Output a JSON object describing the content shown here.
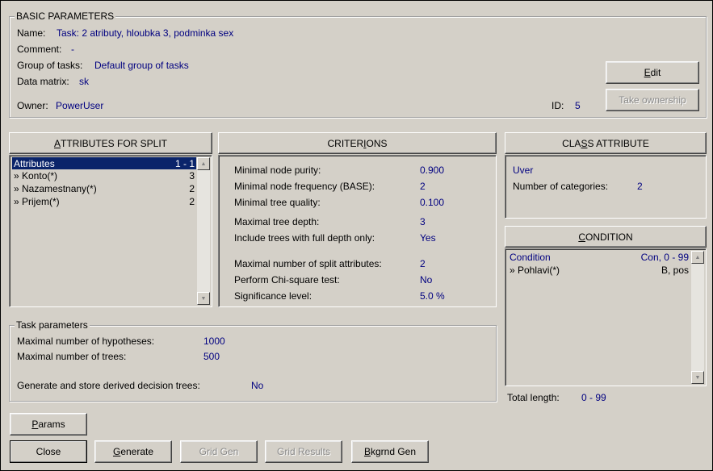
{
  "basic": {
    "title": "BASIC PARAMETERS",
    "name_label": "Name:",
    "name_value": "Task:  2 atributy, hloubka 3, podminka sex",
    "comment_label": "Comment:",
    "comment_value": "-",
    "group_label": "Group of tasks:",
    "group_value": "Default group of tasks",
    "matrix_label": "Data matrix:",
    "matrix_value": "sk",
    "owner_label": "Owner:",
    "owner_value": "PowerUser",
    "id_label": "ID:",
    "id_value": "5",
    "edit_pre": "",
    "edit_ul": "E",
    "edit_post": "dit",
    "take_ownership": "Take ownership"
  },
  "attributes": {
    "header_pre": "",
    "header_ul": "A",
    "header_post": "TTRIBUTES FOR SPLIT",
    "rows": [
      {
        "name": "Attributes",
        "value": "1 - 1"
      },
      {
        "name": "» Konto(*)",
        "value": "3"
      },
      {
        "name": "» Nazamestnany(*)",
        "value": "2"
      },
      {
        "name": "» Prijem(*)",
        "value": "2"
      }
    ]
  },
  "criterions": {
    "header_pre": "CRITER",
    "header_ul": "I",
    "header_post": "ONS",
    "rows": [
      {
        "label": "Minimal node purity:",
        "value": "0.900"
      },
      {
        "label": "Minimal node frequency (BASE):",
        "value": "2"
      },
      {
        "label": "Minimal tree quality:",
        "value": "0.100"
      },
      {
        "label": "Maximal tree depth:",
        "value": "3"
      },
      {
        "label": "Include trees with full depth only:",
        "value": "Yes"
      },
      {
        "label": "Maximal number of split attributes:",
        "value": "2"
      },
      {
        "label": "Perform Chi-square test:",
        "value": "No"
      },
      {
        "label": "Significance level:",
        "value": "5.0 %"
      }
    ]
  },
  "class_attr": {
    "header_pre": "CLA",
    "header_ul": "S",
    "header_post": "S ATTRIBUTE",
    "name": "Uver",
    "categories_label": "Number of categories:",
    "categories_value": "2"
  },
  "condition": {
    "header_pre": "",
    "header_ul": "C",
    "header_post": "ONDITION",
    "rows": [
      {
        "name": "Condition",
        "value": "Con, 0 - 99"
      },
      {
        "name": "» Pohlavi(*)",
        "value": "B, pos"
      }
    ],
    "total_label": "Total length:",
    "total_value": "0 - 99"
  },
  "task": {
    "title": "Task parameters",
    "hyp_label": "Maximal number of hypotheses:",
    "hyp_value": "1000",
    "trees_label": "Maximal number of trees:",
    "trees_value": "500",
    "store_label": "Generate and store derived decision trees:",
    "store_value": "No"
  },
  "buttons": {
    "params_pre": "",
    "params_ul": "P",
    "params_post": "arams",
    "close": "Close",
    "generate_pre": "",
    "generate_ul": "G",
    "generate_post": "enerate",
    "grid_gen": "Grid Gen",
    "grid_results": "Grid Results",
    "bkgrnd_pre": "",
    "bkgrnd_ul": "B",
    "bkgrnd_post": "kgrnd Gen"
  },
  "colors": {
    "value_text": "#000080",
    "selection": "#0a246a",
    "face": "#d4d0c8"
  }
}
